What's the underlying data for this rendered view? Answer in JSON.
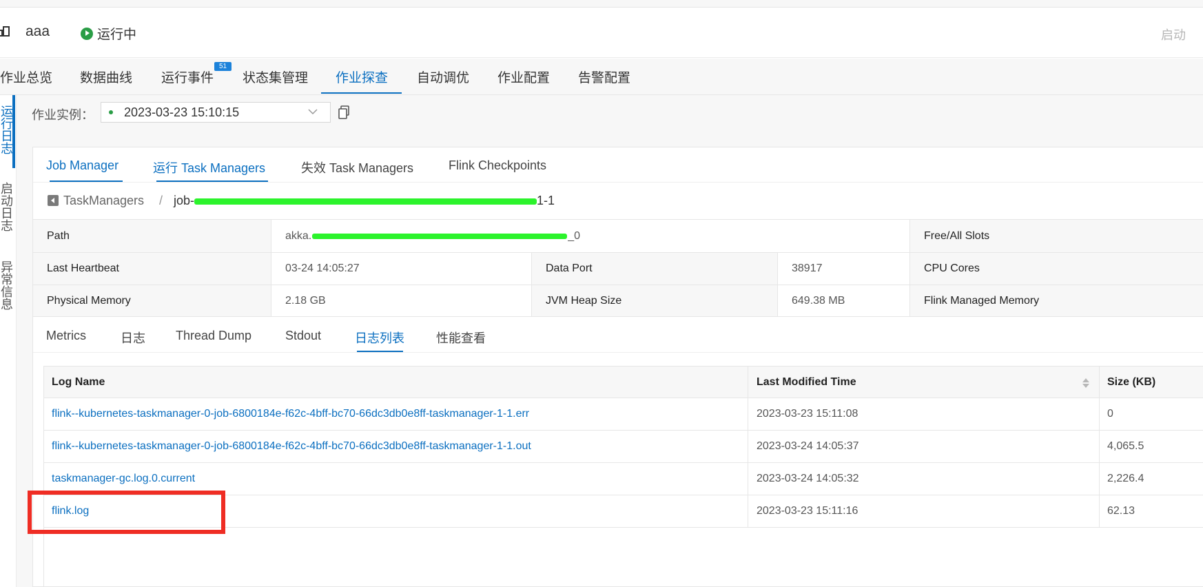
{
  "header": {
    "app_name": "aaa",
    "status": "运行中",
    "start_button": "启动"
  },
  "main_tabs": [
    {
      "label": "作业总览"
    },
    {
      "label": "数据曲线"
    },
    {
      "label": "运行事件",
      "badge": "51"
    },
    {
      "label": "状态集管理"
    },
    {
      "label": "作业探查",
      "active": true
    },
    {
      "label": "自动调优"
    },
    {
      "label": "作业配置"
    },
    {
      "label": "告警配置"
    }
  ],
  "sidebar": {
    "items": [
      {
        "label": "运行日志",
        "active": true
      },
      {
        "label": "启动日志"
      },
      {
        "label": "异常信息"
      }
    ]
  },
  "instance": {
    "label": "作业实例：",
    "value": "2023-03-23 15:10:15"
  },
  "sub_tabs": [
    {
      "label": "Job Manager"
    },
    {
      "label": "运行 Task Managers",
      "active": true
    },
    {
      "label": "失效 Task Managers"
    },
    {
      "label": "Flink Checkpoints"
    }
  ],
  "breadcrumb": {
    "parent": "TaskManagers",
    "separator": "/",
    "current_prefix": "job-",
    "current_suffix": "1-1"
  },
  "info": {
    "path_label": "Path",
    "path_value_prefix": "akka.",
    "path_value_suffix": "_0",
    "free_slots_label": "Free/All Slots",
    "last_heartbeat_label": "Last Heartbeat",
    "last_heartbeat_value": "03-24 14:05:27",
    "data_port_label": "Data Port",
    "data_port_value": "38917",
    "cpu_cores_label": "CPU Cores",
    "physical_memory_label": "Physical Memory",
    "physical_memory_value": "2.18 GB",
    "jvm_heap_label": "JVM Heap Size",
    "jvm_heap_value": "649.38 MB",
    "flink_managed_label": "Flink Managed Memory"
  },
  "inner_tabs": [
    {
      "label": "Metrics"
    },
    {
      "label": "日志"
    },
    {
      "label": "Thread Dump"
    },
    {
      "label": "Stdout"
    },
    {
      "label": "日志列表",
      "active": true
    },
    {
      "label": "性能查看"
    }
  ],
  "log_table": {
    "headers": [
      "Log Name",
      "Last Modified Time",
      "Size (KB)"
    ],
    "rows": [
      {
        "name": "flink--kubernetes-taskmanager-0-job-6800184e-f62c-4bff-bc70-66dc3db0e8ff-taskmanager-1-1.err",
        "time": "2023-03-23 15:11:08",
        "size": "0"
      },
      {
        "name": "flink--kubernetes-taskmanager-0-job-6800184e-f62c-4bff-bc70-66dc3db0e8ff-taskmanager-1-1.out",
        "time": "2023-03-24 14:05:37",
        "size": "4,065.5"
      },
      {
        "name": "taskmanager-gc.log.0.current",
        "time": "2023-03-24 14:05:32",
        "size": "2,226.4"
      },
      {
        "name": "flink.log",
        "time": "2023-03-23 15:11:16",
        "size": "62.13"
      }
    ]
  },
  "colors": {
    "accent": "#0b6fc0",
    "running": "#2a9d46",
    "highlight": "#ef2d24",
    "redaction": "#2cf32c"
  }
}
